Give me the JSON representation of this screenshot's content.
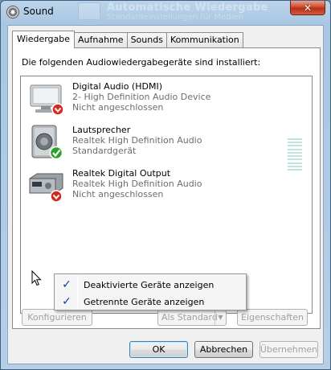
{
  "window": {
    "title": "Sound",
    "close_glyph": "✕",
    "background_title": "Automatische Wiedergabe",
    "background_subtitle": "Standardeinstellungen für Medien"
  },
  "tabs": [
    {
      "label": "Wiedergabe",
      "active": true
    },
    {
      "label": "Aufnahme",
      "active": false
    },
    {
      "label": "Sounds",
      "active": false
    },
    {
      "label": "Kommunikation",
      "active": false
    }
  ],
  "intro": "Die folgenden Audiowiedergabegeräte sind installiert:",
  "devices": [
    {
      "name": "Digital Audio (HDMI)",
      "line2": "2- High Definition Audio Device",
      "line3": "Nicht angeschlossen",
      "icon": "monitor-icon",
      "status": "disconnected"
    },
    {
      "name": "Lautsprecher",
      "line2": "Realtek High Definition Audio",
      "line3": "Standardgerät",
      "icon": "speaker-icon",
      "status": "default"
    },
    {
      "name": "Realtek Digital Output",
      "line2": "Realtek High Definition Audio",
      "line3": "Nicht angeschlossen",
      "icon": "receiver-icon",
      "status": "disconnected"
    }
  ],
  "context_menu": {
    "items": [
      {
        "label": "Deaktivierte Geräte anzeigen",
        "checked": true
      },
      {
        "label": "Getrennte Geräte anzeigen",
        "checked": true
      }
    ]
  },
  "panel_buttons": {
    "configure": "Konfigurieren",
    "set_default": "Als Standard",
    "properties": "Eigenschaften"
  },
  "dialog_buttons": {
    "ok": "OK",
    "cancel": "Abbrechen",
    "apply": "Übernehmen"
  },
  "colors": {
    "status_disconnected": "#d12b1f",
    "status_default": "#2ea02e",
    "menu_check": "#0b3fa8"
  }
}
